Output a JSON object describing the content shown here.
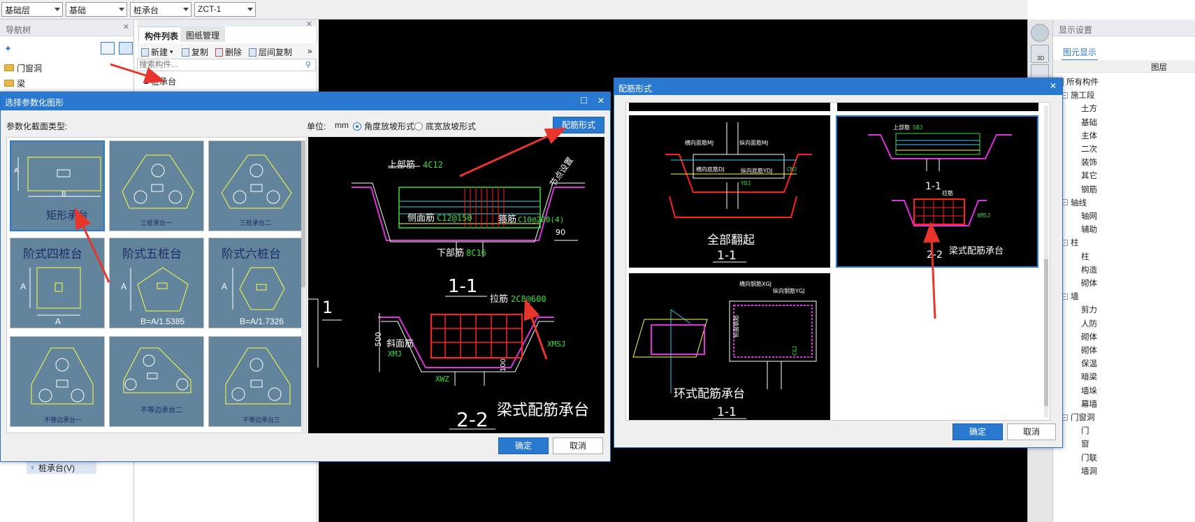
{
  "topbar": {
    "combos": [
      "基础层",
      "基础",
      "桩承台",
      "ZCT-1"
    ]
  },
  "nav": {
    "title": "导航树",
    "items": [
      "门窗洞",
      "梁"
    ],
    "bottom_item": "桩承台(V)"
  },
  "complist": {
    "tabs": [
      "构件列表",
      "图纸管理"
    ],
    "toolbar": [
      "新建",
      "复制",
      "删除",
      "层间复制"
    ],
    "search_placeholder": "搜索构件...",
    "tree_root": "桩承台"
  },
  "display_panel": {
    "title": "显示设置",
    "tab": "图元显示",
    "col_header": "图层",
    "rows": [
      "所有构件",
      "施工段",
      "土方",
      "基础",
      "主体",
      "二次",
      "装饰",
      "其它",
      "钢筋",
      "轴线",
      "轴网",
      "辅助",
      "柱",
      "柱",
      "构造",
      "砌体",
      "墙",
      "剪力",
      "人防",
      "砌体",
      "砌体",
      "保温",
      "暗梁",
      "墙垛",
      "幕墙",
      "门窗洞",
      "门",
      "窗",
      "门联",
      "墙洞"
    ]
  },
  "dialog1": {
    "title": "选择参数化图形",
    "section_label": "参数化截面类型:",
    "unit_label": "单位:",
    "unit_value": "mm",
    "radio1": "角度放坡形式",
    "radio2": "底宽放坡形式",
    "rebar_form_button": "配筋形式",
    "thumbs": [
      {
        "name": "矩形承台",
        "dimA": "A",
        "dimB": "B"
      },
      {
        "name": "三桩承台一"
      },
      {
        "name": "三桩承台二"
      },
      {
        "name": "阶式四桩台",
        "dimA": "A",
        "dimB": "A"
      },
      {
        "name": "阶式五桩台",
        "dimA": "A",
        "dimB": "B=A/1.5385"
      },
      {
        "name": "阶式六桩台",
        "dimA": "A",
        "dimB": "B=A/1.7326"
      },
      {
        "name": "不等边承台一"
      },
      {
        "name": "不等边承台二"
      },
      {
        "name": "不等边承台三"
      }
    ],
    "preview": {
      "top_rebar_label": "上部筋",
      "top_rebar_value": "4C12",
      "side_rebar_label": "侧面筋",
      "side_rebar_value": "C12@150",
      "stirrup_label": "箍筋",
      "stirrup_value": "C10@200(4)",
      "bottom_rebar_label": "下部筋",
      "bottom_rebar_value": "8C16",
      "section1": "1-1",
      "tie_label": "拉筋",
      "tie_value": "2C8@600",
      "slope_label": "斜面筋",
      "slope_value": "XMJ",
      "xwz": "XWZ",
      "xmsj": "XMSJ",
      "dim_500": "500",
      "dim_100": "100",
      "angle": "90",
      "node_note": "节点设置",
      "section2": "2-2",
      "caption": "梁式配筋承台",
      "side_marker": "1"
    },
    "ok": "确定",
    "cancel": "取消"
  },
  "dialog2": {
    "title": "配筋形式",
    "panels": [
      {
        "caption": "全部翻起",
        "section": "1-1",
        "labels": [
          "横向面筋MJ",
          "纵向面筋MJ",
          "横向底筋DJ",
          "纵向底筋YDJ",
          "CMJ",
          "YDJ"
        ]
      },
      {
        "caption": "梁式配筋承台",
        "section1": "1-1",
        "section2": "2-2",
        "labels": [
          "上部筋",
          "SBJ",
          "拉筋",
          "XMSJ"
        ]
      },
      {
        "caption": "环式配筋承台",
        "section": "1-1",
        "labels": [
          "横向钢筋XGJ",
          "纵向钢筋YGJ",
          "侧面钢筋",
          "CGJ"
        ]
      }
    ],
    "ok": "确定",
    "cancel": "取消"
  },
  "colors": {
    "title_bar": "#2a79d0",
    "thumb_bg": "#62849c",
    "arrow": "#e8352b",
    "cad_bg": "#000000",
    "rebar_red": "#ff2020",
    "rebar_green": "#35e035",
    "slab_magenta": "#e030e0"
  }
}
